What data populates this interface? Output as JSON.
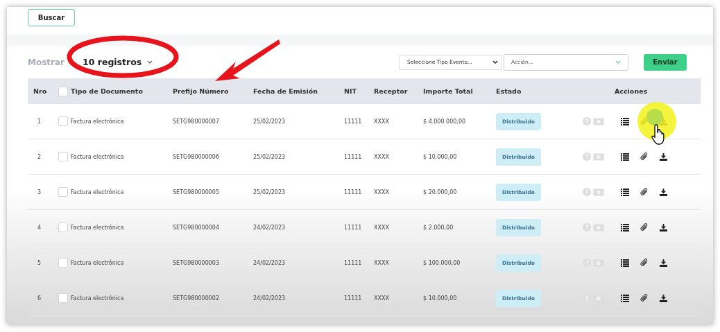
{
  "search_button": "Buscar",
  "show": {
    "label": "Mostrar",
    "value": "10 registros"
  },
  "event_select": {
    "value": "Seleccione Tipo Evento..."
  },
  "action_select": {
    "placeholder": "Acción..."
  },
  "send_button": "Enviar",
  "table": {
    "columns": [
      "Nro",
      "Tipo de Documento",
      "Prefijo Número",
      "Fecha de Emisión",
      "NIT",
      "Receptor",
      "Importe Total",
      "Estado",
      "Acciones"
    ],
    "select_all": {
      "checked": false
    },
    "rows": [
      {
        "nro": "1",
        "checked": false,
        "tipo": "Factura electrónica",
        "prefijo": "SETG980000007",
        "fecha": "25/02/2023",
        "nit": "11111",
        "receptor": "XXXX",
        "importe": "$ 4.000.000,00",
        "estado": "Distribuido"
      },
      {
        "nro": "2",
        "checked": false,
        "tipo": "Factura electrónica",
        "prefijo": "SETG980000006",
        "fecha": "25/02/2023",
        "nit": "11111",
        "receptor": "XXXX",
        "importe": "$ 10.000,00",
        "estado": "Distribuido"
      },
      {
        "nro": "3",
        "checked": false,
        "tipo": "Factura electrónica",
        "prefijo": "SETG980000005",
        "fecha": "25/02/2023",
        "nit": "11111",
        "receptor": "XXXX",
        "importe": "$ 20.000,00",
        "estado": "Distribuido"
      },
      {
        "nro": "4",
        "checked": false,
        "tipo": "Factura electrónica",
        "prefijo": "SETG980000004",
        "fecha": "24/02/2023",
        "nit": "11111",
        "receptor": "XXXX",
        "importe": "$ 2.000,00",
        "estado": "Distribuido"
      },
      {
        "nro": "5",
        "checked": false,
        "tipo": "Factura electrónica",
        "prefijo": "SETG980000003",
        "fecha": "24/02/2023",
        "nit": "11111",
        "receptor": "XXXX",
        "importe": "$ 100.000,00",
        "estado": "Distribuido"
      },
      {
        "nro": "6",
        "checked": false,
        "tipo": "Factura electrónica",
        "prefijo": "SETG980000002",
        "fecha": "24/02/2023",
        "nit": "11111",
        "receptor": "XXXX",
        "importe": "$ 10.000,00",
        "estado": "Distribuido"
      }
    ]
  }
}
